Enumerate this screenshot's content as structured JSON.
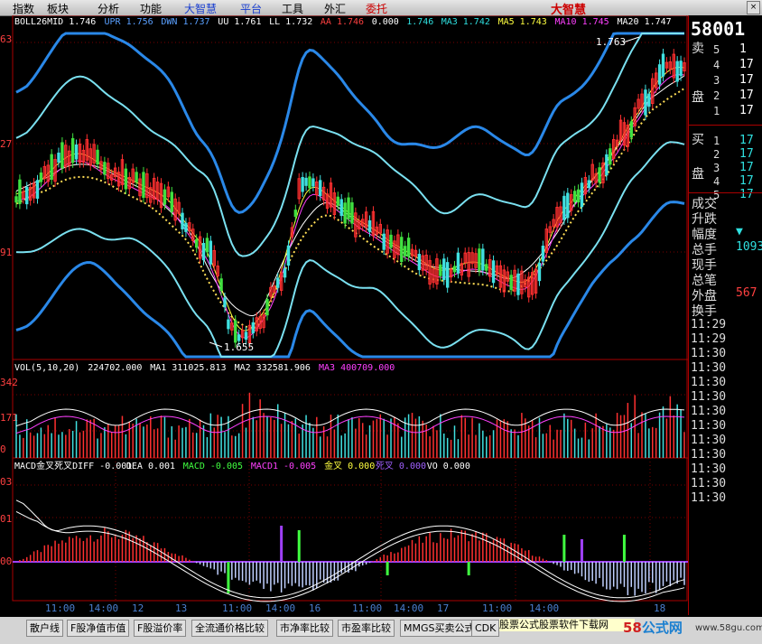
{
  "menu": [
    {
      "label": "指数",
      "style": ""
    },
    {
      "label": "板块",
      "style": ""
    },
    {
      "label": "分析",
      "style": ""
    },
    {
      "label": "功能",
      "style": ""
    },
    {
      "label": "大智慧",
      "style": "hl"
    },
    {
      "label": "平台",
      "style": "hl"
    },
    {
      "label": "工具",
      "style": ""
    },
    {
      "label": "外汇",
      "style": ""
    },
    {
      "label": "委托",
      "style": "red"
    }
  ],
  "logo": "大智慧",
  "boll_legend": [
    {
      "text": "BOLL26MID 1.746",
      "color": "#ffffff"
    },
    {
      "text": "UPR 1.756",
      "color": "#5aa0ff"
    },
    {
      "text": "DWN 1.737",
      "color": "#5aa0ff"
    },
    {
      "text": "UU 1.761",
      "color": "#ffffff"
    },
    {
      "text": "LL 1.732",
      "color": "#ffffff"
    },
    {
      "text": "AA 1.746",
      "color": "#ff4040"
    },
    {
      "text": "0.000",
      "color": "#ffffff"
    },
    {
      "text": "1.746",
      "color": "#2fe0e0"
    },
    {
      "text": "MA3 1.742",
      "color": "#2fe0e0"
    },
    {
      "text": "MA5 1.743",
      "color": "#ffff40"
    },
    {
      "text": "MA10 1.745",
      "color": "#ff40ff"
    },
    {
      "text": "MA20 1.747",
      "color": "#ffffff"
    }
  ],
  "price_axis": [
    "63",
    "27",
    "91"
  ],
  "annotations": {
    "high": "1.763",
    "low": "1.655"
  },
  "vol_legend": [
    {
      "text": "VOL(5,10,20)",
      "color": "#ffffff"
    },
    {
      "text": "224702.000",
      "color": "#ffffff"
    },
    {
      "text": "MA1 311025.813",
      "color": "#ffffff"
    },
    {
      "text": "MA2 332581.906",
      "color": "#ffffff"
    },
    {
      "text": "MA3 400709.000",
      "color": "#ff40ff"
    }
  ],
  "vol_axis": [
    "342",
    "171",
    "0"
  ],
  "macd_legend": [
    {
      "text": "MACD金叉死叉DIFF -0.001",
      "color": "#ffffff"
    },
    {
      "text": "DEA 0.001",
      "color": "#ffffff"
    },
    {
      "text": "MACD -0.005",
      "color": "#40ff40"
    },
    {
      "text": "MACD1 -0.005",
      "color": "#ff40ff"
    },
    {
      "text": "金叉 0.000",
      "color": "#ffff40"
    },
    {
      "text": "死叉 0.000",
      "color": "#a060ff"
    },
    {
      "text": "VO 0.000",
      "color": "#ffffff"
    }
  ],
  "macd_axis": [
    "03",
    "01",
    "00"
  ],
  "time_axis": [
    "11:00",
    "14:00",
    "12",
    "13",
    "11:00",
    "14:00",
    "16",
    "11:00",
    "14:00",
    "17",
    "11:00",
    "14:00",
    "18"
  ],
  "right_panel": {
    "stock_code": "58001",
    "sell_label": "卖盘",
    "buy_label": "买盘",
    "sell_levels": [
      "5",
      "4",
      "3",
      "2",
      "1"
    ],
    "sell_values": [
      "1",
      "17",
      "17",
      "17",
      "17"
    ],
    "buy_levels": [
      "1",
      "2",
      "3",
      "4",
      "5"
    ],
    "buy_values": [
      "17",
      "17",
      "17",
      "17",
      "17"
    ],
    "stats": [
      {
        "label": "成交",
        "value": ""
      },
      {
        "label": "升跌",
        "value": ""
      },
      {
        "label": "幅度",
        "value": "▼"
      },
      {
        "label": "总手",
        "value": "1093"
      },
      {
        "label": "现手",
        "value": ""
      },
      {
        "label": "总笔",
        "value": ""
      },
      {
        "label": "外盘",
        "value": "567"
      },
      {
        "label": "换手",
        "value": ""
      }
    ],
    "times": [
      "11:29",
      "11:29",
      "11:30",
      "11:30",
      "11:30",
      "11:30",
      "11:30",
      "11:30",
      "11:30",
      "11:30",
      "11:30",
      "11:30",
      "11:30"
    ]
  },
  "bottom_tabs": [
    "散户线",
    "F股净值市值",
    "F股溢价率",
    "全流通价格比较",
    "市净率比较",
    "市盈率比较",
    "MMGS买卖公式",
    "CDK"
  ],
  "ad_banner": "股票公式股票软件下载网",
  "watermark": {
    "num": "58",
    "text": "公式网",
    "url": "www.58gu.com"
  }
}
